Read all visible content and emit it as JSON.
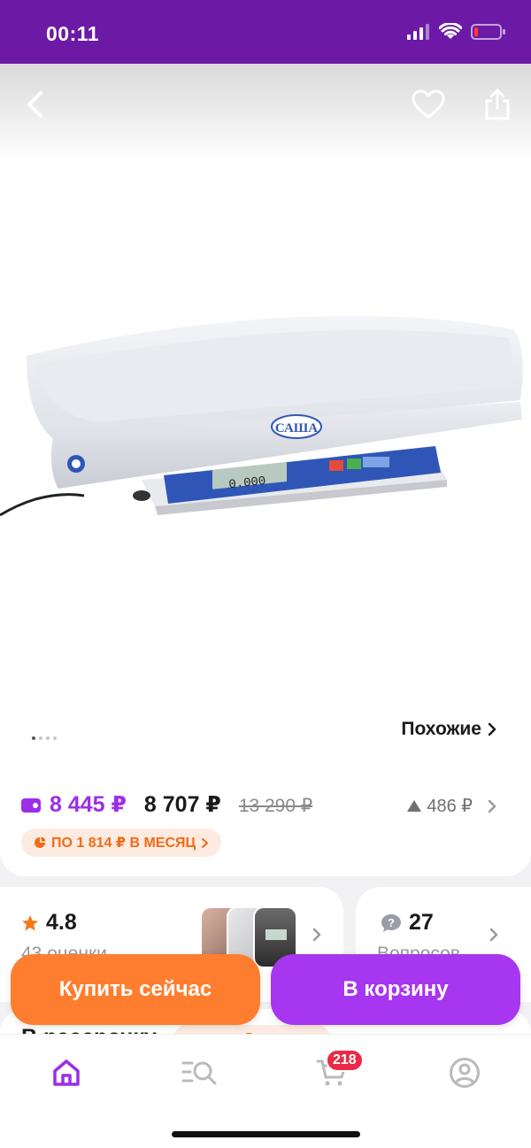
{
  "status_bar": {
    "time": "00:11"
  },
  "gallery": {
    "brand_badge": "САША",
    "display_reading": "0.000",
    "similar_label": "Похожие",
    "dots_count": 4,
    "active_dot": 0
  },
  "price": {
    "wallet_price": "8 445 ₽",
    "current_price": "8 707 ₽",
    "old_price": "13 290 ₽",
    "price_drop": "486 ₽",
    "installment_badge": "ПО 1 814 ₽ В МЕСЯЦ"
  },
  "rating": {
    "value": "4.8",
    "count_label": "43 оценки"
  },
  "questions": {
    "count": "27",
    "label": "Вопросов"
  },
  "installments_section": {
    "title": "В рассрочку",
    "badge": "ПО 1 814 ₽ В МЕСЯЦ"
  },
  "actions": {
    "buy_now": "Купить сейчас",
    "add_to_cart": "В корзину"
  },
  "tabbar": {
    "cart_count": "218"
  },
  "colors": {
    "brand_purple": "#6c1aa6",
    "accent_purple": "#a636f0",
    "accent_orange": "#ff7d2e",
    "badge_red": "#ea2a47"
  }
}
